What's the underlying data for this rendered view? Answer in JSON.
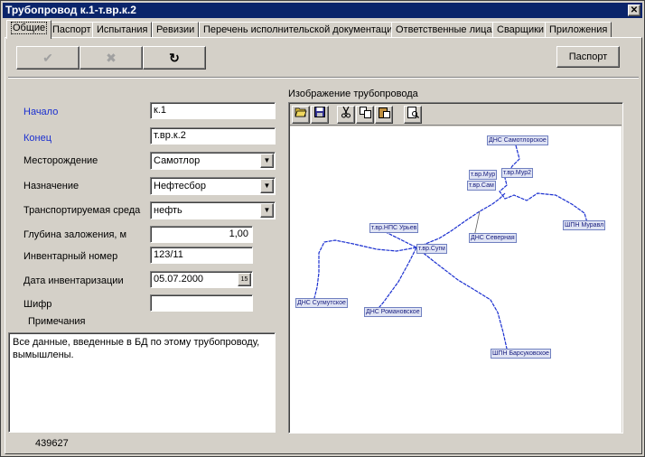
{
  "window": {
    "title": "Трубопровод к.1-т.вр.к.2",
    "close_label": "✕"
  },
  "tabs": [
    {
      "label": "Общие"
    },
    {
      "label": "Паспорт"
    },
    {
      "label": "Испытания"
    },
    {
      "label": "Ревизии"
    },
    {
      "label": "Перечень исполнительской документации"
    },
    {
      "label": "Ответственные лица"
    },
    {
      "label": "Сварщики"
    },
    {
      "label": "Приложения"
    }
  ],
  "toolbar": {
    "confirm_icon": "✔",
    "cancel_icon": "✖",
    "refresh_icon": "↻",
    "passport_label": "Паспорт"
  },
  "form": {
    "start_label": "Начало",
    "start_value": "к.1",
    "end_label": "Конец",
    "end_value": "т.вр.к.2",
    "field_label": "Месторождение",
    "field_value": "Самотлор",
    "purpose_label": "Назначение",
    "purpose_value": "Нефтесбор",
    "medium_label": "Транспортируемая среда",
    "medium_value": "нефть",
    "depth_label": "Глубина заложения, м",
    "depth_value": "1,00",
    "inventory_label": "Инвентарный номер",
    "inventory_value": "123/11",
    "date_label": "Дата инвентаризации",
    "date_value": "05.07.2000",
    "date_btn": "15",
    "code_label": "Шифр",
    "code_value": "",
    "notes_label": "Примечания",
    "notes_text": "Все данные, введенные в БД по этому трубопроводу, вымышлены."
  },
  "status": {
    "record_id": "439627"
  },
  "image": {
    "title": "Изображение трубопровода",
    "toolbar_icons": [
      "open-folder-icon",
      "save-icon",
      "cut-icon",
      "copy-icon",
      "paste-icon",
      "preview-icon"
    ],
    "nodes": [
      {
        "label": "ДНС Самотлорское"
      },
      {
        "label": "т.вр.Мур"
      },
      {
        "label": "т.вр.Сам"
      },
      {
        "label": "т.вр.Мур2"
      },
      {
        "label": "ДНС Северная"
      },
      {
        "label": "ШПН Муравл"
      },
      {
        "label": "т.вр.НПС Урьев"
      },
      {
        "label": "т.вр.Сугм"
      },
      {
        "label": "ДНС Сугмутское"
      },
      {
        "label": "ДНС Романовское"
      },
      {
        "label": "ШПН Барсуковское"
      }
    ],
    "line_color": "#1a2fd0"
  }
}
